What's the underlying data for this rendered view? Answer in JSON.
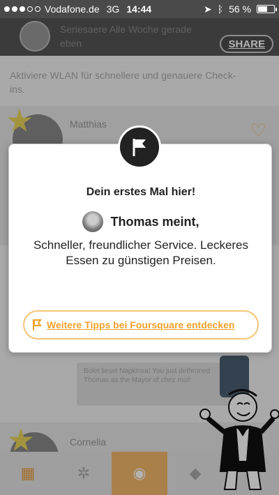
{
  "status_bar": {
    "carrier": "Vodafone.de",
    "network": "3G",
    "time": "14:44",
    "battery_percent": "56 %",
    "battery_level": 0.56
  },
  "header": {
    "share_label": "SHARE",
    "feed_text": "Seriesaere Alle Woche gerade eben"
  },
  "background": {
    "wlan_hint": "Aktiviere WLAN für schnellere und genauere Check-ins.",
    "card1_name": "Matthias",
    "card2_name": "Cornelia",
    "notification": "Bolet liesel Napkinsa! You just dethroned Thomas as the Mayor of chez moi!"
  },
  "dialog": {
    "title": "Dein erstes Mal hier!",
    "author": "Thomas meint,",
    "tip": "Schneller, freundlicher Service. Leckeres Essen zu günstigen Preisen.",
    "button_label": "Weitere Tipps bei Foursquare entdecken"
  },
  "colors": {
    "accent": "#f0a02a",
    "tab_active": "#f4b86a"
  }
}
